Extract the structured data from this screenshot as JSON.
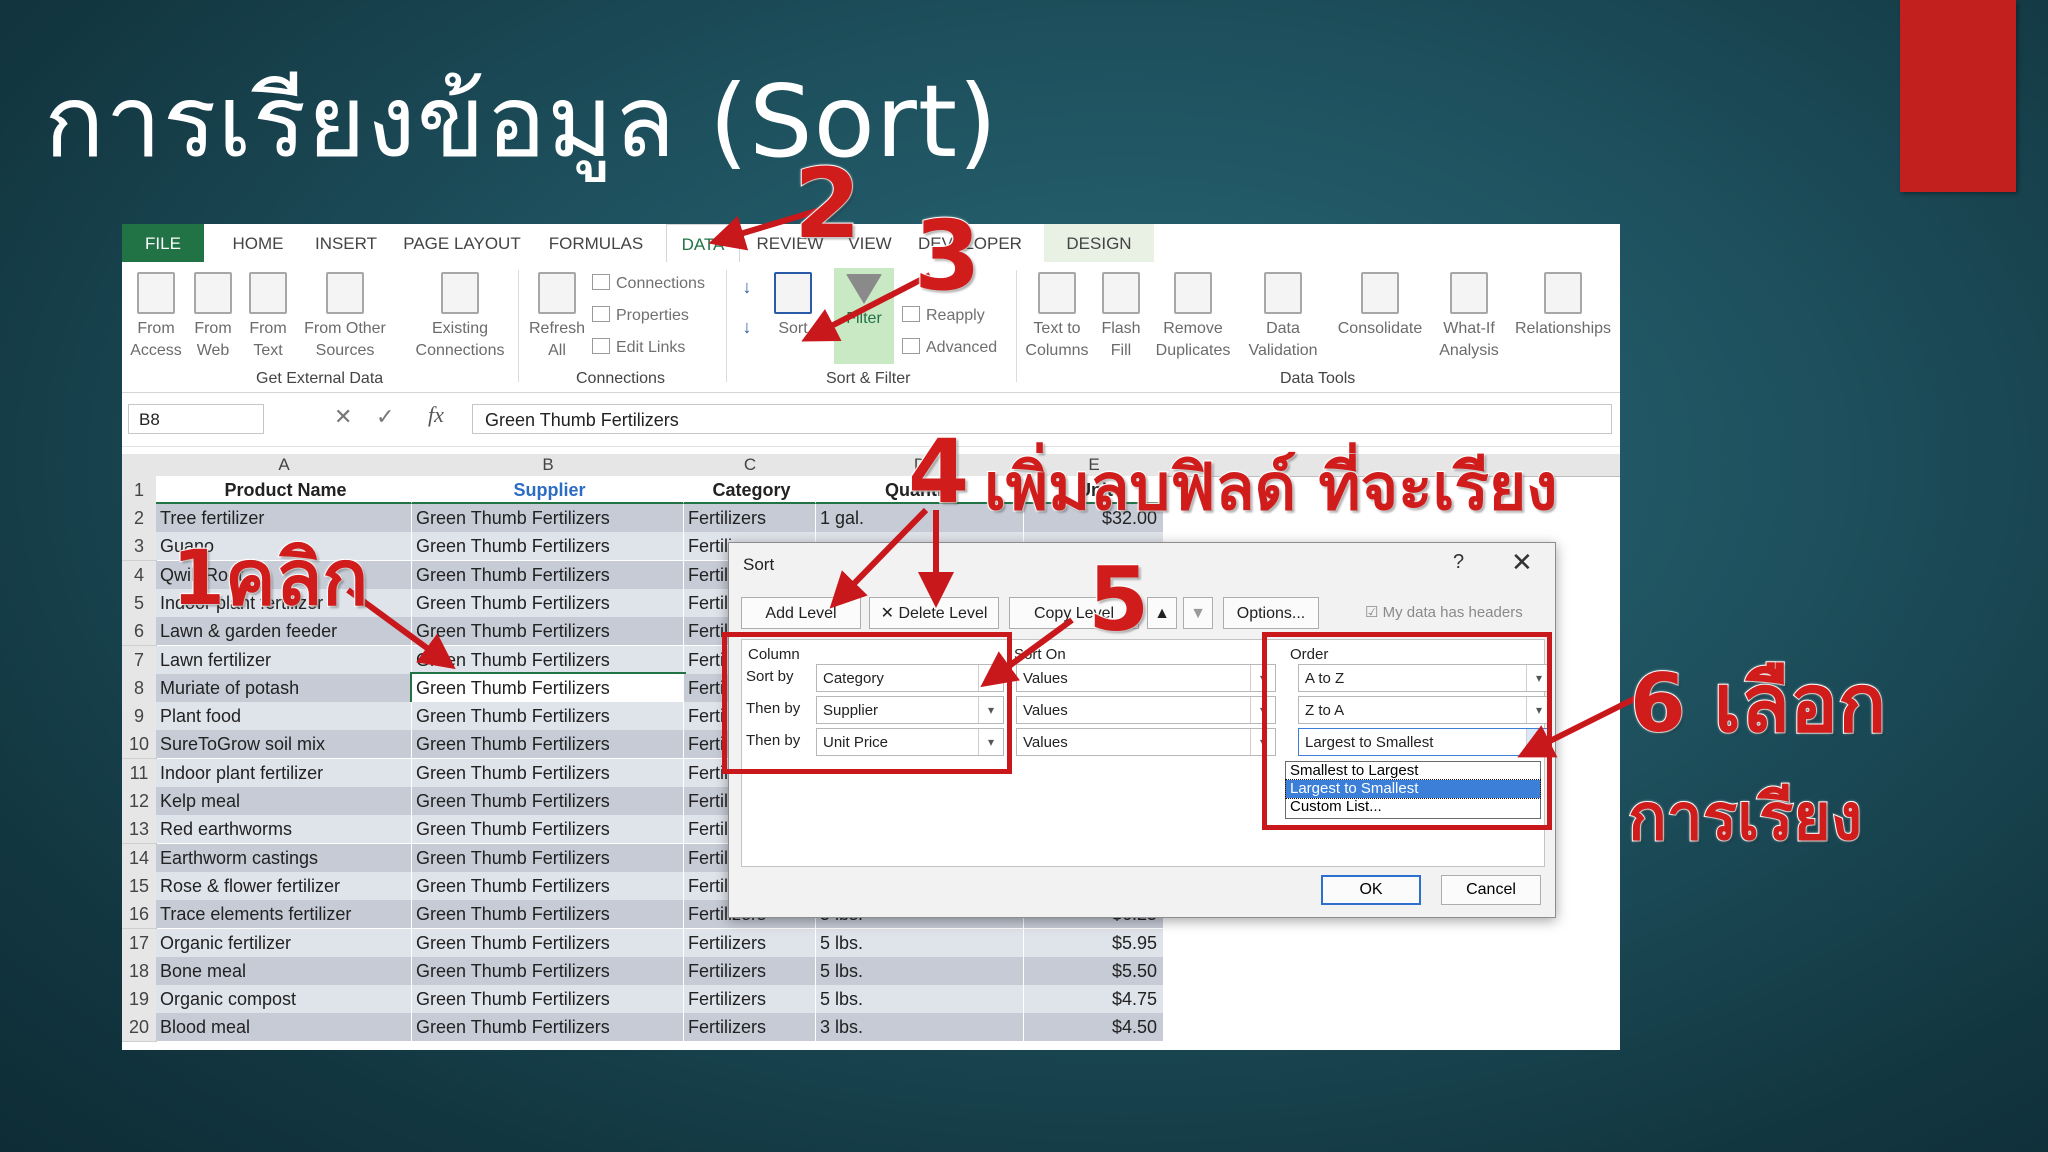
{
  "slide": {
    "title": "การเรียงข้อมูล (Sort)"
  },
  "excel": {
    "tabs": [
      "FILE",
      "HOME",
      "INSERT",
      "PAGE LAYOUT",
      "FORMULAS",
      "DATA",
      "REVIEW",
      "VIEW",
      "DEVELOPER",
      "DESIGN"
    ],
    "ribbon": {
      "get_external": {
        "from_access": "From Access",
        "from_web": "From Web",
        "from_text": "From Text",
        "from_other": "From Other Sources",
        "existing": "Existing Connections",
        "group": "Get External Data"
      },
      "connections": {
        "refresh": "Refresh All",
        "connections": "Connections",
        "properties": "Properties",
        "edit_links": "Edit Links",
        "group": "Connections"
      },
      "sort_filter": {
        "sort": "Sort",
        "filter": "Filter",
        "reapply": "Reapply",
        "advanced": "Advanced",
        "group": "Sort & Filter"
      },
      "data_tools": {
        "text_to_columns": "Text to Columns",
        "flash_fill": "Flash Fill",
        "remove_duplicates": "Remove Duplicates",
        "data_validation": "Data Validation",
        "consolidate": "Consolidate",
        "what_if": "What-If Analysis",
        "relationships": "Relationships",
        "group": "Data Tools"
      }
    },
    "name_box": "B8",
    "formula": "Green Thumb Fertilizers",
    "columns": [
      "A",
      "B",
      "C",
      "D",
      "E"
    ],
    "headers": [
      "Product Name",
      "Supplier",
      "Category",
      "Quantity",
      "Unit"
    ],
    "rows": [
      {
        "n": "2",
        "a": "Tree fertilizer",
        "b": "Green Thumb Fertilizers",
        "c": "Fertilizers",
        "d": "1 gal.",
        "e": "$32.00"
      },
      {
        "n": "3",
        "a": "Guano",
        "b": "Green Thumb Fertilizers",
        "c": "Fertilizers",
        "d": "",
        "e": ""
      },
      {
        "n": "4",
        "a": "Qwik Root",
        "b": "Green Thumb Fertilizers",
        "c": "Fertilizers",
        "d": "",
        "e": ""
      },
      {
        "n": "5",
        "a": "Indoor plant fertilizer",
        "b": "Green Thumb Fertilizers",
        "c": "Fertilizers",
        "d": "",
        "e": ""
      },
      {
        "n": "6",
        "a": "Lawn & garden feeder",
        "b": "Green Thumb Fertilizers",
        "c": "Fertilizers",
        "d": "",
        "e": ""
      },
      {
        "n": "7",
        "a": "Lawn fertilizer",
        "b": "Green Thumb Fertilizers",
        "c": "Fertilizers",
        "d": "",
        "e": ""
      },
      {
        "n": "8",
        "a": "Muriate of potash",
        "b": "Green Thumb Fertilizers",
        "c": "Fertilizers",
        "d": "",
        "e": ""
      },
      {
        "n": "9",
        "a": "Plant food",
        "b": "Green Thumb Fertilizers",
        "c": "Fertilizers",
        "d": "",
        "e": ""
      },
      {
        "n": "10",
        "a": "SureToGrow soil mix",
        "b": "Green Thumb Fertilizers",
        "c": "Fertilizers",
        "d": "",
        "e": ""
      },
      {
        "n": "11",
        "a": "Indoor plant fertilizer",
        "b": "Green Thumb Fertilizers",
        "c": "Fertilizers",
        "d": "",
        "e": ""
      },
      {
        "n": "12",
        "a": "Kelp meal",
        "b": "Green Thumb Fertilizers",
        "c": "Fertilizers",
        "d": "",
        "e": ""
      },
      {
        "n": "13",
        "a": "Red earthworms",
        "b": "Green Thumb Fertilizers",
        "c": "Fertilizers",
        "d": "",
        "e": ""
      },
      {
        "n": "14",
        "a": "Earthworm castings",
        "b": "Green Thumb Fertilizers",
        "c": "Fertilizers",
        "d": "",
        "e": ""
      },
      {
        "n": "15",
        "a": "Rose & flower fertilizer",
        "b": "Green Thumb Fertilizers",
        "c": "Fertilizers",
        "d": "",
        "e": ""
      },
      {
        "n": "16",
        "a": "Trace elements fertilizer",
        "b": "Green Thumb Fertilizers",
        "c": "Fertilizers",
        "d": "5 lbs.",
        "e": "$6.25"
      },
      {
        "n": "17",
        "a": "Organic fertilizer",
        "b": "Green Thumb Fertilizers",
        "c": "Fertilizers",
        "d": "5 lbs.",
        "e": "$5.95"
      },
      {
        "n": "18",
        "a": "Bone meal",
        "b": "Green Thumb Fertilizers",
        "c": "Fertilizers",
        "d": "5 lbs.",
        "e": "$5.50"
      },
      {
        "n": "19",
        "a": "Organic compost",
        "b": "Green Thumb Fertilizers",
        "c": "Fertilizers",
        "d": "5 lbs.",
        "e": "$4.75"
      },
      {
        "n": "20",
        "a": "Blood meal",
        "b": "Green Thumb Fertilizers",
        "c": "Fertilizers",
        "d": "3 lbs.",
        "e": "$4.50"
      }
    ]
  },
  "sort_dialog": {
    "title": "Sort",
    "help": "?",
    "close": "✕",
    "add_level": "Add Level",
    "delete_level": "Delete Level",
    "copy_level": "Copy Level",
    "options": "Options...",
    "my_data_headers": "My data has headers",
    "col_header": "Column",
    "sorton_header": "Sort On",
    "order_header": "Order",
    "levels": [
      {
        "label": "Sort by",
        "column": "Category",
        "sort_on": "Values",
        "order": "A to Z"
      },
      {
        "label": "Then by",
        "column": "Supplier",
        "sort_on": "Values",
        "order": "Z to A"
      },
      {
        "label": "Then by",
        "column": "Unit Price",
        "sort_on": "Values",
        "order": "Largest to Smallest"
      }
    ],
    "order_options": [
      "Smallest to Largest",
      "Largest to Smallest",
      "Custom List..."
    ],
    "ok": "OK",
    "cancel": "Cancel"
  },
  "annotations": {
    "n1": "1คลิก",
    "n2": "2",
    "n3": "3",
    "n4": "4",
    "add_remove": "เพิ่มลบฟิลด์ ที่จะเรียง",
    "n5": "5",
    "n6": "6 เลือก",
    "sort_word": "การเรียง"
  },
  "colors": {
    "accent": "#217346",
    "annotation": "#d11c1c",
    "slide_bg": "#1d4f5c"
  }
}
